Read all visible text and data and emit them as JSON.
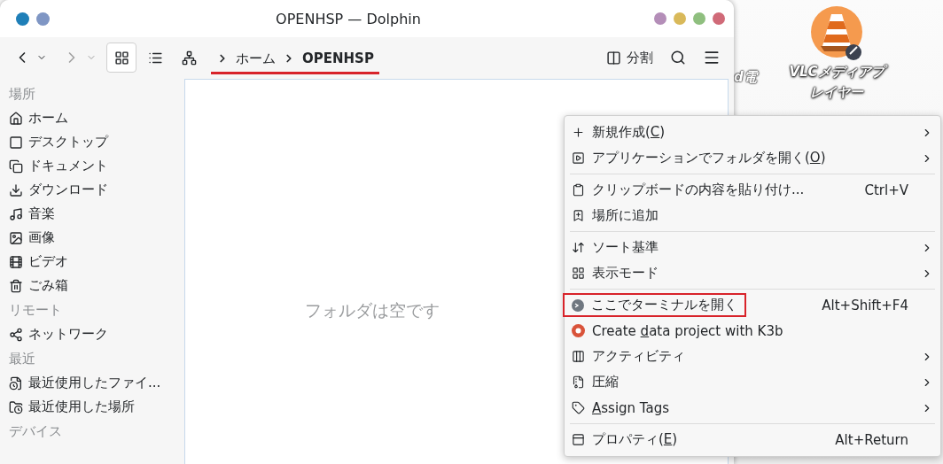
{
  "window": {
    "title": "OPENHSP — Dolphin",
    "title_buttons": [
      {
        "color": "#b48eb8"
      },
      {
        "color": "#d9b95a"
      },
      {
        "color": "#8fbf7f"
      },
      {
        "color": "#d06a78"
      }
    ]
  },
  "toolbar": {
    "back": {
      "disabled": false
    },
    "forward": {
      "disabled": true
    },
    "view_modes": [
      {
        "kind": "icons",
        "selected": true
      },
      {
        "kind": "details",
        "selected": false
      },
      {
        "kind": "tree",
        "selected": false
      }
    ],
    "breadcrumb": {
      "highlighted": true,
      "items": [
        {
          "label": "ホーム",
          "current": false
        },
        {
          "label": "OPENHSP",
          "current": true
        }
      ]
    },
    "split_label": "分割"
  },
  "sidebar": {
    "sections": [
      {
        "title": "場所",
        "items": [
          {
            "kind": "home",
            "label": "ホーム"
          },
          {
            "kind": "desktop",
            "label": "デスクトップ"
          },
          {
            "kind": "documents",
            "label": "ドキュメント"
          },
          {
            "kind": "downloads",
            "label": "ダウンロード"
          },
          {
            "kind": "music",
            "label": "音楽"
          },
          {
            "kind": "pictures",
            "label": "画像"
          },
          {
            "kind": "videos",
            "label": "ビデオ"
          },
          {
            "kind": "trash",
            "label": "ごみ箱"
          }
        ]
      },
      {
        "title": "リモート",
        "items": [
          {
            "kind": "network",
            "label": "ネットワーク"
          }
        ]
      },
      {
        "title": "最近",
        "items": [
          {
            "kind": "recent-files",
            "label": "最近使用したファイ..."
          },
          {
            "kind": "recent-places",
            "label": "最近使用した場所"
          }
        ]
      },
      {
        "title": "デバイス"
      }
    ]
  },
  "content": {
    "empty_text": "フォルダは空です"
  },
  "desktop": {
    "partial_label": "d電",
    "icons": [
      {
        "label": "VLCメディアプレイヤー",
        "linked": true
      }
    ]
  },
  "context_menu": {
    "groups": [
      [
        {
          "kind": "new",
          "pre": "新規作成(",
          "mnemonic": "C",
          "post": ")",
          "submenu": true
        },
        {
          "kind": "open-with",
          "pre": "アプリケーションでフォルダを開く(",
          "mnemonic": "O",
          "post": ")",
          "submenu": true
        }
      ],
      [
        {
          "kind": "paste",
          "pre": "クリップボードの内容を貼り付け...",
          "shortcut": "Ctrl+V",
          "submenu": false
        },
        {
          "kind": "add-place",
          "pre": "場所に追加",
          "submenu": false
        }
      ],
      [
        {
          "kind": "sort",
          "pre": "ソート基準",
          "submenu": true
        },
        {
          "kind": "view-mode",
          "pre": "表示モード",
          "submenu": true
        }
      ],
      [
        {
          "kind": "terminal",
          "pre": "ここでターミナルを開く",
          "shortcut": "Alt+Shift+F4",
          "submenu": false,
          "highlighted": true
        },
        {
          "kind": "k3b",
          "pre": "Create ",
          "mnemonic": "d",
          "post": "ata project with K3b",
          "submenu": false
        },
        {
          "kind": "activities",
          "pre": "アクティビティ",
          "submenu": true
        },
        {
          "kind": "compress",
          "pre": "圧縮",
          "submenu": true
        },
        {
          "kind": "tags",
          "mnemonic": "A",
          "post": "ssign Tags",
          "submenu": true
        }
      ],
      [
        {
          "kind": "properties",
          "pre": "プロパティ(",
          "mnemonic": "E",
          "post": ")",
          "shortcut": "Alt+Return",
          "submenu": false
        }
      ]
    ]
  }
}
